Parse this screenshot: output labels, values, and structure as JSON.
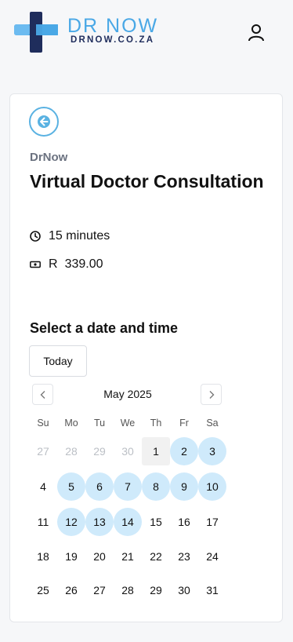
{
  "brand": {
    "name": "DR NOW",
    "domain": "DRNOW.CO.ZA",
    "colors": {
      "primary": "#4aa8e6",
      "dark": "#1f2d5c"
    }
  },
  "header": {
    "user_icon": "user-icon"
  },
  "event": {
    "organizer": "DrNow",
    "title": "Virtual Doctor Consultation",
    "duration": "15 minutes",
    "price_currency": "R",
    "price_amount": "339.00"
  },
  "scheduler": {
    "heading": "Select a date and time",
    "today_label": "Today",
    "month_label": "May 2025",
    "weekdays": [
      "Su",
      "Mo",
      "Tu",
      "We",
      "Th",
      "Fr",
      "Sa"
    ],
    "weeks": [
      [
        {
          "d": "27",
          "s": "muted"
        },
        {
          "d": "28",
          "s": "muted"
        },
        {
          "d": "29",
          "s": "muted"
        },
        {
          "d": "30",
          "s": "muted"
        },
        {
          "d": "1",
          "s": "today"
        },
        {
          "d": "2",
          "s": "avail"
        },
        {
          "d": "3",
          "s": "avail"
        }
      ],
      [
        {
          "d": "4",
          "s": ""
        },
        {
          "d": "5",
          "s": "avail"
        },
        {
          "d": "6",
          "s": "avail"
        },
        {
          "d": "7",
          "s": "avail"
        },
        {
          "d": "8",
          "s": "avail"
        },
        {
          "d": "9",
          "s": "avail"
        },
        {
          "d": "10",
          "s": "avail"
        }
      ],
      [
        {
          "d": "11",
          "s": ""
        },
        {
          "d": "12",
          "s": "avail"
        },
        {
          "d": "13",
          "s": "avail"
        },
        {
          "d": "14",
          "s": "avail"
        },
        {
          "d": "15",
          "s": ""
        },
        {
          "d": "16",
          "s": ""
        },
        {
          "d": "17",
          "s": ""
        }
      ],
      [
        {
          "d": "18",
          "s": ""
        },
        {
          "d": "19",
          "s": ""
        },
        {
          "d": "20",
          "s": ""
        },
        {
          "d": "21",
          "s": ""
        },
        {
          "d": "22",
          "s": ""
        },
        {
          "d": "23",
          "s": ""
        },
        {
          "d": "24",
          "s": ""
        }
      ],
      [
        {
          "d": "25",
          "s": ""
        },
        {
          "d": "26",
          "s": ""
        },
        {
          "d": "27",
          "s": ""
        },
        {
          "d": "28",
          "s": ""
        },
        {
          "d": "29",
          "s": ""
        },
        {
          "d": "30",
          "s": ""
        },
        {
          "d": "31",
          "s": ""
        }
      ]
    ]
  }
}
